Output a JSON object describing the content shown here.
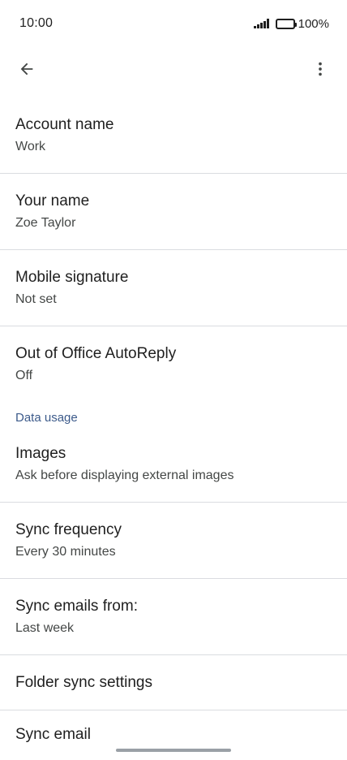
{
  "status_bar": {
    "time": "10:00",
    "battery": "100%"
  },
  "app_bar": {
    "back_icon": "arrow-back-icon",
    "menu_icon": "more-vert-icon"
  },
  "items": {
    "account_name": {
      "title": "Account name",
      "subtitle": "Work"
    },
    "your_name": {
      "title": "Your name",
      "subtitle": "Zoe Taylor"
    },
    "mobile_signature": {
      "title": "Mobile signature",
      "subtitle": "Not set"
    },
    "out_of_office": {
      "title": "Out of Office AutoReply",
      "subtitle": "Off"
    },
    "images": {
      "title": "Images",
      "subtitle": "Ask before displaying external images"
    },
    "sync_frequency": {
      "title": "Sync frequency",
      "subtitle": "Every 30 minutes"
    },
    "sync_emails_from": {
      "title": "Sync emails from:",
      "subtitle": "Last week"
    },
    "folder_sync": {
      "title": "Folder sync settings"
    },
    "partial": {
      "title": "Sync email"
    }
  },
  "sections": {
    "data_usage": "Data usage"
  },
  "colors": {
    "section_header": "#3c5a8a",
    "divider": "#dadce0"
  }
}
